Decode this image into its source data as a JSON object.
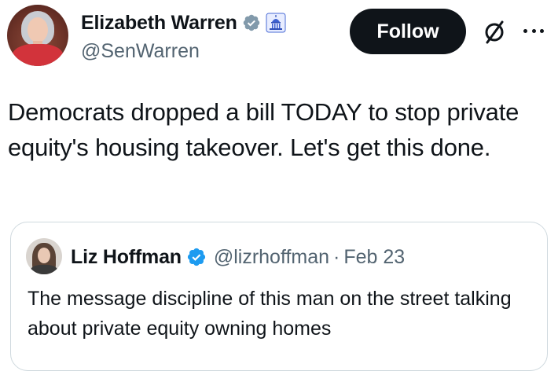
{
  "author": {
    "name": "Elizabeth Warren",
    "handle": "@SenWarren",
    "verified_icon": "verified-badge-icon",
    "affiliation_icon": "us-capitol-icon"
  },
  "actions": {
    "follow_label": "Follow",
    "grok_icon": "grok-icon",
    "more_icon": "more-dots-icon"
  },
  "tweet": {
    "text": "Democrats dropped a bill TODAY to stop private equity's housing takeover. Let's get this done."
  },
  "quote": {
    "name": "Liz Hoffman",
    "handle": "@lizrhoffman",
    "separator": "·",
    "date": "Feb 23",
    "text": "The message discipline of this man on the street talking about private equity owning homes"
  },
  "colors": {
    "text": "#0f1419",
    "secondary_text": "#536471",
    "verified_blue": "#1d9bf0",
    "follow_button_bg": "#0f1419",
    "border": "#cfd9de"
  }
}
